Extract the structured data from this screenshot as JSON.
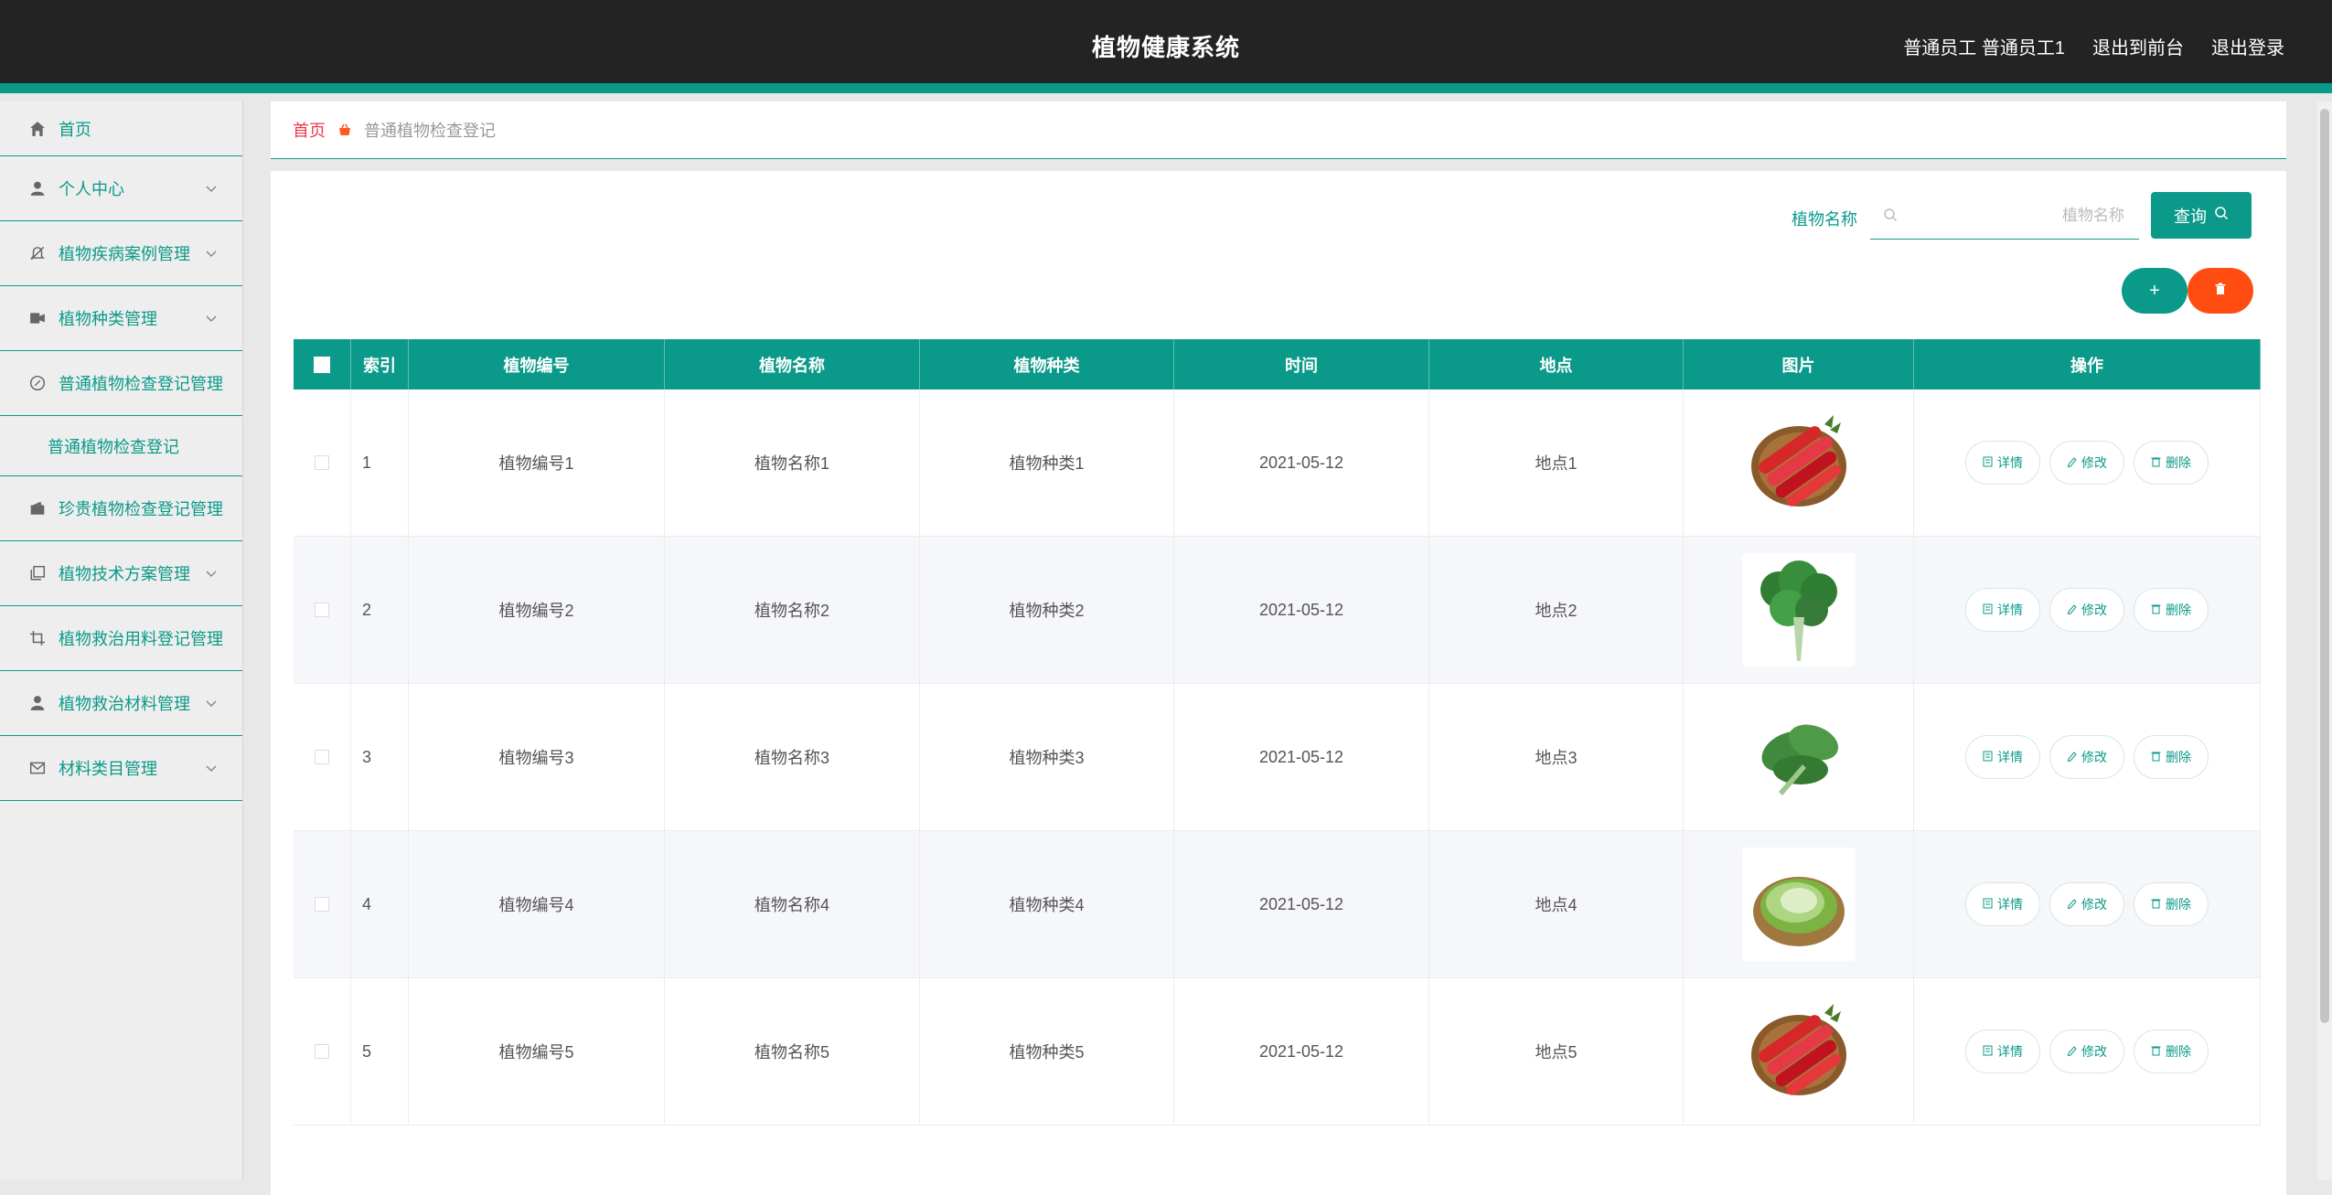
{
  "header": {
    "title": "植物健康系统",
    "user": "普通员工 普通员工1",
    "to_front": "退出到前台",
    "logout": "退出登录"
  },
  "sidebar": {
    "items": [
      {
        "label": "首页",
        "icon": "home-icon"
      },
      {
        "label": "个人中心",
        "icon": "user-icon"
      },
      {
        "label": "植物疾病案例管理",
        "icon": "bell-off-icon"
      },
      {
        "label": "植物种类管理",
        "icon": "ticket-icon"
      },
      {
        "label": "普通植物检查登记管理",
        "icon": "compass-icon"
      },
      {
        "label": "普通植物检查登记",
        "icon": ""
      },
      {
        "label": "珍贵植物检查登记管理",
        "icon": "wallet-icon"
      },
      {
        "label": "植物技术方案管理",
        "icon": "copy-icon"
      },
      {
        "label": "植物救治用料登记管理",
        "icon": "crop-icon"
      },
      {
        "label": "植物救治材料管理",
        "icon": "person-icon"
      },
      {
        "label": "材料类目管理",
        "icon": "mail-icon"
      }
    ]
  },
  "breadcrumb": {
    "home": "首页",
    "current": "普通植物检查登记"
  },
  "search": {
    "label": "植物名称",
    "placeholder": "植物名称",
    "value": "",
    "button": "查询"
  },
  "actions": {
    "add": "+"
  },
  "table": {
    "headers": [
      "索引",
      "植物编号",
      "植物名称",
      "植物种类",
      "时间",
      "地点",
      "图片",
      "操作"
    ],
    "op_labels": {
      "detail": "详情",
      "edit": "修改",
      "delete": "删除"
    },
    "rows": [
      {
        "index": "1",
        "code": "植物编号1",
        "name": "植物名称1",
        "type": "植物种类1",
        "time": "2021-05-12",
        "place": "地点1",
        "image": "carrots"
      },
      {
        "index": "2",
        "code": "植物编号2",
        "name": "植物名称2",
        "type": "植物种类2",
        "time": "2021-05-12",
        "place": "地点2",
        "image": "parsley"
      },
      {
        "index": "3",
        "code": "植物编号3",
        "name": "植物名称3",
        "type": "植物种类3",
        "time": "2021-05-12",
        "place": "地点3",
        "image": "spinach"
      },
      {
        "index": "4",
        "code": "植物编号4",
        "name": "植物名称4",
        "type": "植物种类4",
        "time": "2021-05-12",
        "place": "地点4",
        "image": "lettuce"
      },
      {
        "index": "5",
        "code": "植物编号5",
        "name": "植物名称5",
        "type": "植物种类5",
        "time": "2021-05-12",
        "place": "地点5",
        "image": "carrots"
      }
    ]
  },
  "colors": {
    "accent": "#0b9a8a",
    "danger": "#ff4d12",
    "topbar": "#232323",
    "breadcrumb_home": "#e8394a"
  }
}
